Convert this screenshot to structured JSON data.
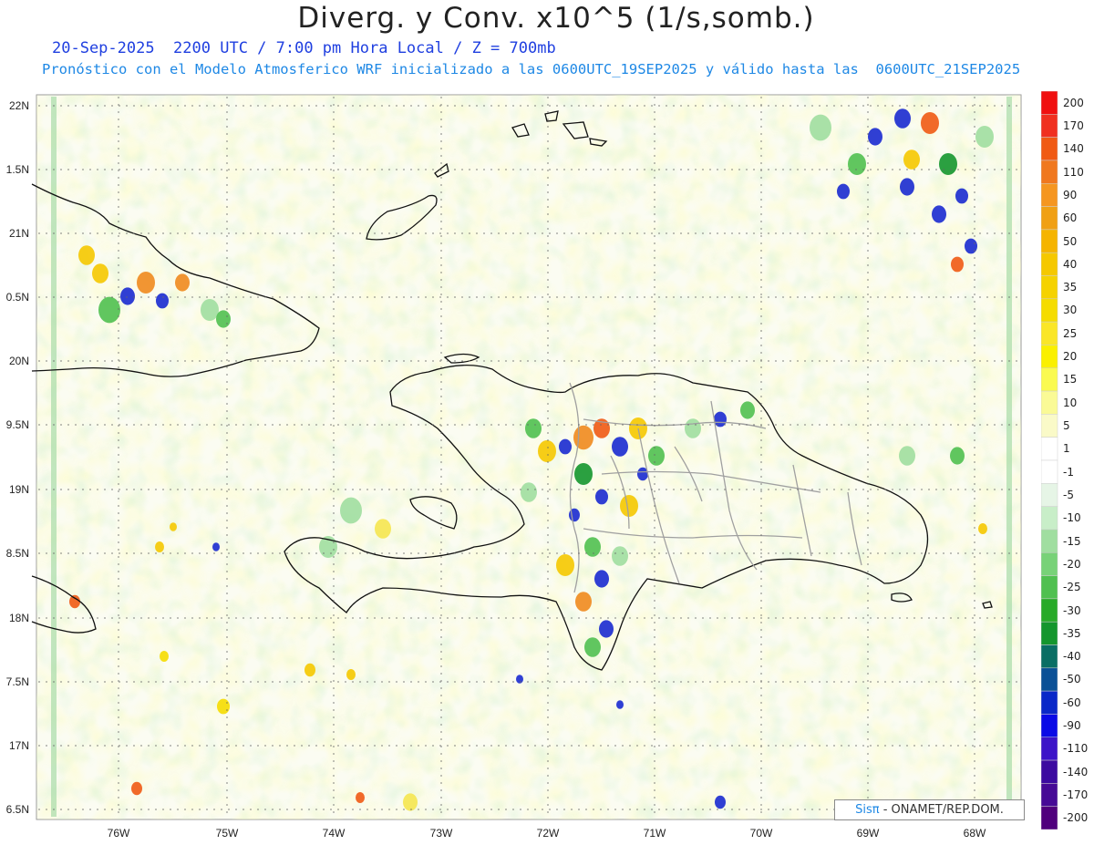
{
  "header": {
    "title": "Diverg. y Conv. x10^5 (1/s,somb.)",
    "subtitle1": "20-Sep-2025  2200 UTC / 7:00 pm Hora Local / Z = 700mb",
    "subtitle2": "Pronóstico con el Modelo Atmosferico WRF inicializado a las 0600UTC_19SEP2025 y válido hasta las  0600UTC_21SEP2025"
  },
  "map": {
    "lon_labels": [
      "76W",
      "75W",
      "74W",
      "73W",
      "72W",
      "71W",
      "70W",
      "69W",
      "68W"
    ],
    "lat_labels": [
      "22N",
      "1.5N",
      "21N",
      "0.5N",
      "20N",
      "9.5N",
      "19N",
      "8.5N",
      "18N",
      "7.5N",
      "17N",
      "6.5N"
    ],
    "lon_range": [
      -76.6,
      -67.6
    ],
    "lat_range": [
      16.5,
      22.05
    ]
  },
  "credit": {
    "brand": "Sisπ",
    "rest": "- ONAMET/REP.DOM."
  },
  "legend": {
    "labels": [
      "200",
      "170",
      "140",
      "110",
      "90",
      "60",
      "50",
      "40",
      "35",
      "30",
      "25",
      "20",
      "15",
      "10",
      "5",
      "1",
      "-1",
      "-5",
      "-10",
      "-15",
      "-20",
      "-25",
      "-30",
      "-35",
      "-40",
      "-50",
      "-60",
      "-90",
      "-110",
      "-140",
      "-170",
      "-200"
    ],
    "colors": [
      "#f01010",
      "#f03020",
      "#f05a14",
      "#f0781e",
      "#f59620",
      "#f0a014",
      "#f5b400",
      "#f5c800",
      "#f5d200",
      "#f5dc00",
      "#fae628",
      "#faf000",
      "#fafa50",
      "#fafa96",
      "#fafac8",
      "#ffffff",
      "#ffffff",
      "#e6f5e6",
      "#c8eec8",
      "#a0dea0",
      "#78d278",
      "#50c050",
      "#28aa28",
      "#14962d",
      "#0a6e64",
      "#0a5096",
      "#0a28c8",
      "#0a0ae6",
      "#3c14c8",
      "#3c0aa0",
      "#460a96",
      "#50007d"
    ]
  }
}
